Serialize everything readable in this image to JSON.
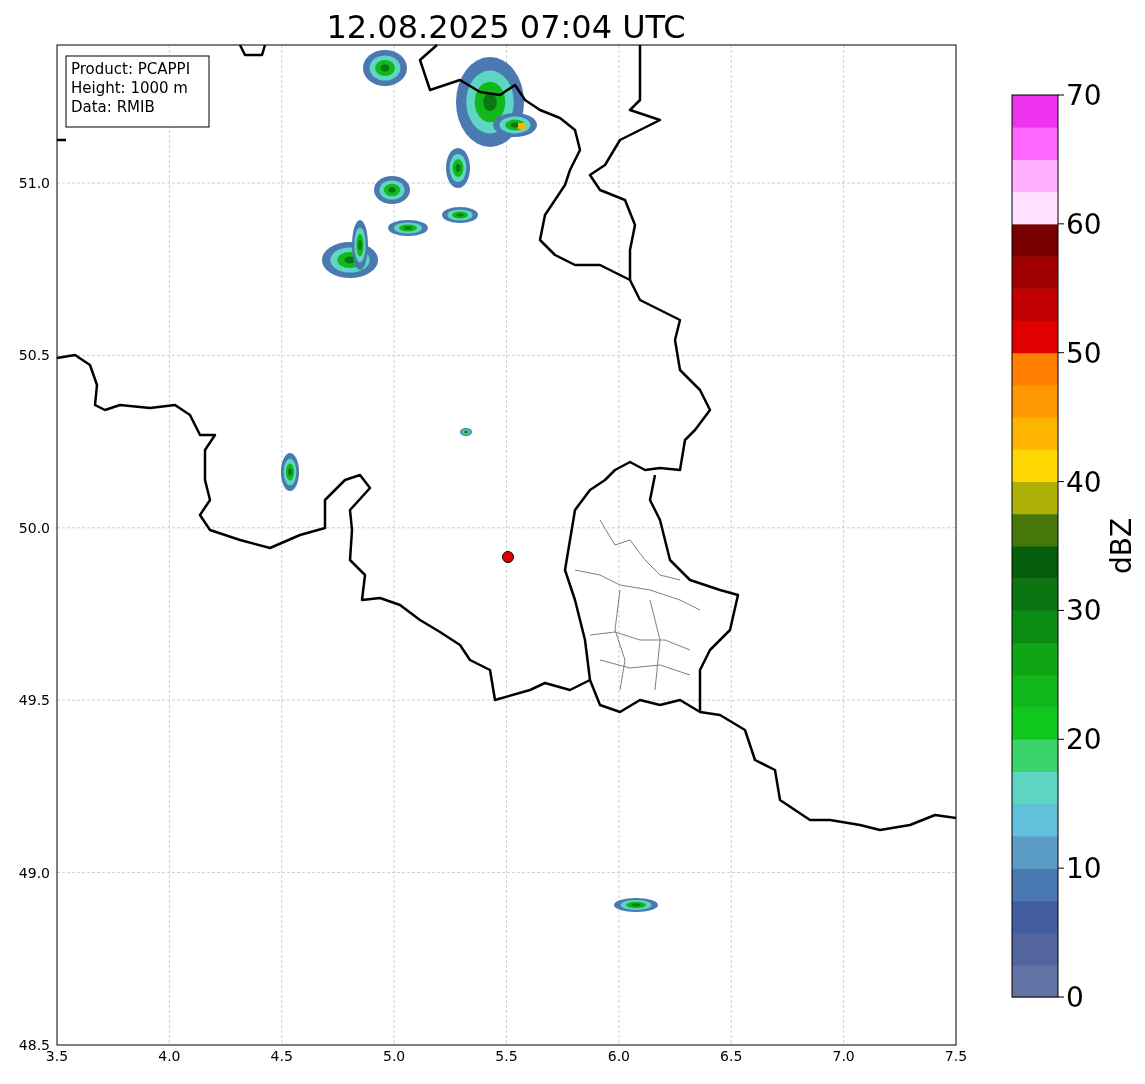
{
  "title": "12.08.2025 07:04 UTC",
  "info_box": [
    "Product: PCAPPI",
    "Height: 1000 m",
    "Data: RMIB"
  ],
  "map": {
    "x_ticks": [
      "3.5",
      "4.0",
      "4.5",
      "5.0",
      "5.5",
      "6.0",
      "6.5",
      "7.0",
      "7.5"
    ],
    "y_ticks": [
      "51.0",
      "50.5",
      "50.0",
      "49.5",
      "49.0",
      "48.5"
    ]
  },
  "colorbar": {
    "label": "dBZ",
    "ticks": [
      "70",
      "60",
      "50",
      "40",
      "30",
      "20",
      "10",
      "0"
    ],
    "bands": [
      {
        "color": "#6373a6"
      },
      {
        "color": "#53659e"
      },
      {
        "color": "#435ea0"
      },
      {
        "color": "#4a78b0"
      },
      {
        "color": "#5b9cc7"
      },
      {
        "color": "#63c0dc"
      },
      {
        "color": "#5fd6c3"
      },
      {
        "color": "#3bd46c"
      },
      {
        "color": "#10c81c"
      },
      {
        "color": "#10b81c"
      },
      {
        "color": "#0fa515"
      },
      {
        "color": "#0d8c12"
      },
      {
        "color": "#0b7511"
      },
      {
        "color": "#075f0e"
      },
      {
        "color": "#46770a"
      },
      {
        "color": "#adb007"
      },
      {
        "color": "#ffd700"
      },
      {
        "color": "#ffb400"
      },
      {
        "color": "#ff9800"
      },
      {
        "color": "#ff7e00"
      },
      {
        "color": "#e00000"
      },
      {
        "color": "#c00000"
      },
      {
        "color": "#a00000"
      },
      {
        "color": "#780000"
      },
      {
        "color": "#ffe0ff"
      },
      {
        "color": "#ffb0ff"
      },
      {
        "color": "#ff66ff"
      },
      {
        "color": "#ee33ee"
      }
    ]
  }
}
